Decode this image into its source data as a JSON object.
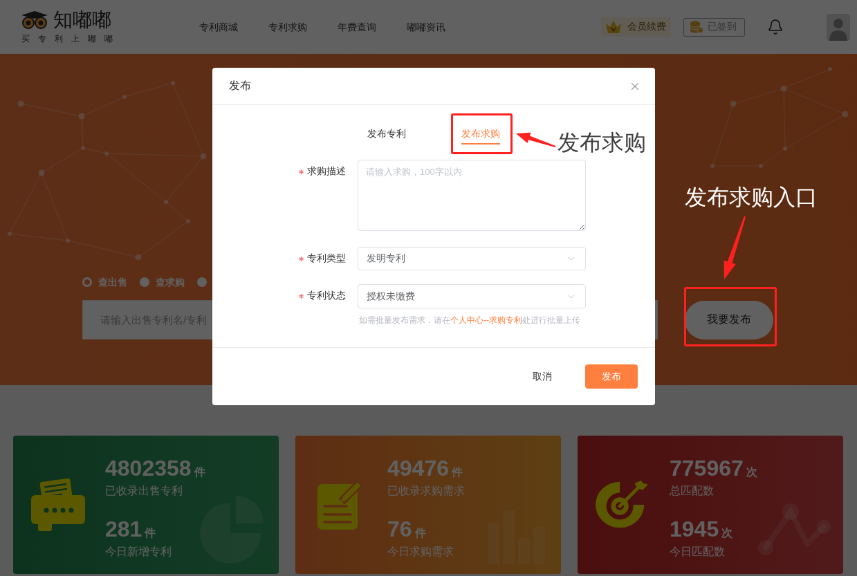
{
  "header": {
    "logo": {
      "name": "知嘟嘟",
      "slogan": "买专利上嘟嘟"
    },
    "nav": [
      {
        "label": "专利商城"
      },
      {
        "label": "专利求购"
      },
      {
        "label": "年费查询"
      },
      {
        "label": "嘟嘟资讯"
      }
    ],
    "member_button": "会员续费",
    "checkin_button": "已签到"
  },
  "hero": {
    "search_modes": [
      {
        "label": "查出售",
        "selected": true
      },
      {
        "label": "查求购",
        "selected": false
      },
      {
        "selected": false
      }
    ],
    "search": {
      "placeholder": "请输入出售专利名/专利"
    },
    "publish_button": "我要发布"
  },
  "stats": [
    {
      "kind": "sale",
      "main": {
        "value": "4802358",
        "unit": "件",
        "label": "已收录出售专利"
      },
      "today": {
        "value": "281",
        "unit": "件",
        "label": "今日新增专利"
      }
    },
    {
      "kind": "demand",
      "main": {
        "value": "49476",
        "unit": "件",
        "label": "已收录求购需求"
      },
      "today": {
        "value": "76",
        "unit": "件",
        "label": "今日求购需求"
      }
    },
    {
      "kind": "match",
      "main": {
        "value": "775967",
        "unit": "次",
        "label": "总匹配数"
      },
      "today": {
        "value": "1945",
        "unit": "次",
        "label": "今日匹配数"
      }
    }
  ],
  "dialog": {
    "title": "发布",
    "tabs": [
      {
        "label": "发布专利",
        "selected": false
      },
      {
        "label": "发布求购",
        "selected": true
      }
    ],
    "fields": [
      {
        "kind": "textarea",
        "label": "求购描述",
        "required": true,
        "placeholder": "请输入求购，100字以内"
      },
      {
        "kind": "select",
        "label": "专利类型",
        "required": true,
        "value": "发明专利"
      },
      {
        "kind": "select",
        "label": "专利状态",
        "required": true,
        "value": "授权未缴费"
      }
    ],
    "hint": {
      "text_before": "如需批量发布需求，请在",
      "link": "个人中心--求购专利",
      "text_after": "处进行批量上传"
    },
    "buttons": [
      {
        "kind": "cancel",
        "label": "取消"
      },
      {
        "kind": "primary",
        "label": "发布"
      }
    ]
  },
  "annotations": [
    {
      "kind": "tab",
      "text": "发布求购"
    },
    {
      "kind": "entry",
      "text": "发布求购入口"
    }
  ]
}
